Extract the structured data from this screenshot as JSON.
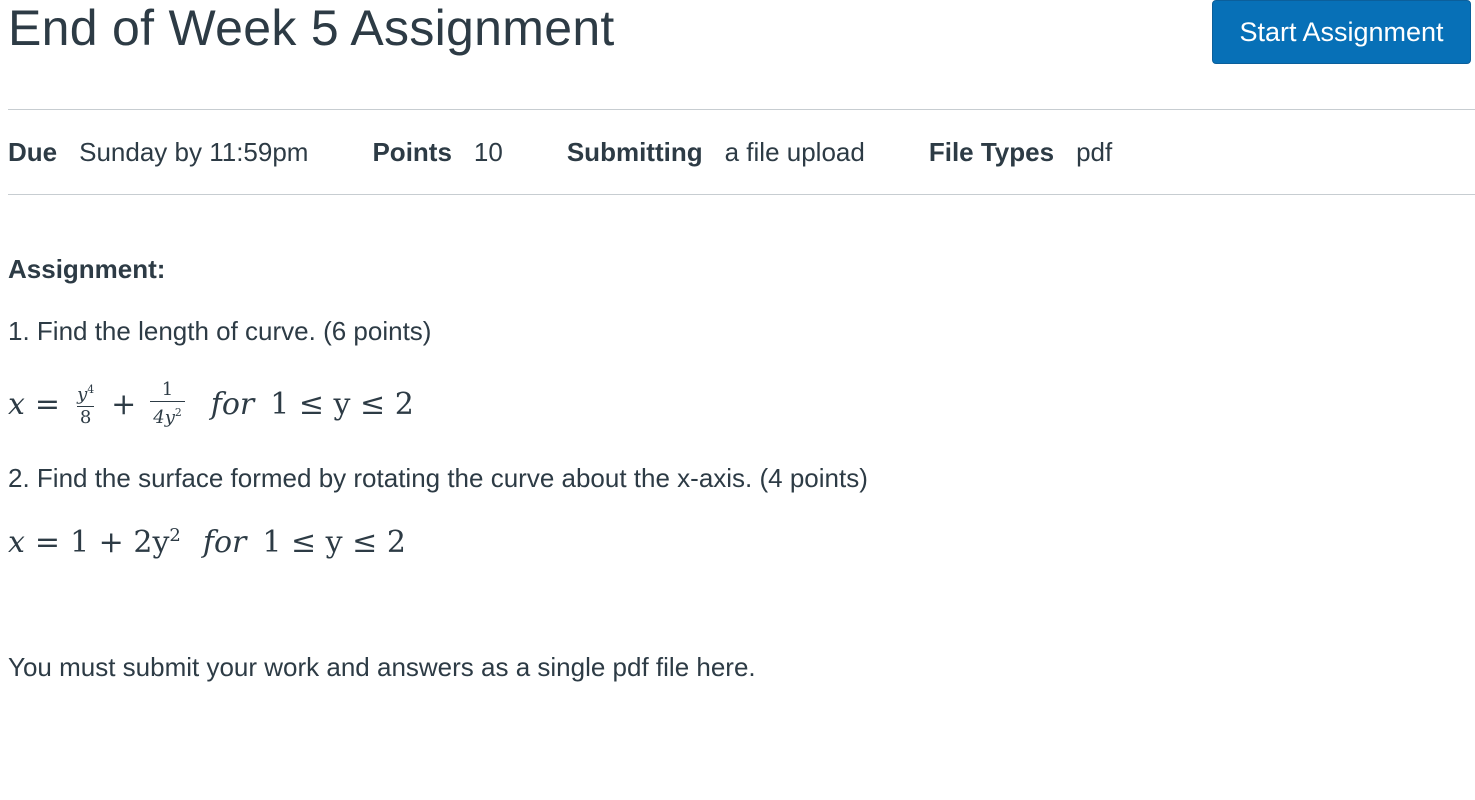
{
  "header": {
    "title": "End of Week 5 Assignment",
    "start_button_label": "Start Assignment"
  },
  "details": [
    {
      "label": "Due",
      "value": "Sunday by 11:59pm"
    },
    {
      "label": "Points",
      "value": "10"
    },
    {
      "label": "Submitting",
      "value": "a file upload"
    },
    {
      "label": "File Types",
      "value": "pdf"
    }
  ],
  "content": {
    "heading": "Assignment:",
    "question1": "1.  Find the length of curve. (6 points)",
    "equation1": {
      "lhs": "x",
      "eq": "=",
      "frac1_num": "y",
      "frac1_num_exp": "4",
      "frac1_den": "8",
      "plus": "+",
      "frac2_num": "1",
      "frac2_den": "4y",
      "frac2_den_exp": "2",
      "for_word": "for",
      "condition": "1 ≤ y ≤ 2"
    },
    "question2": "2.  Find the surface formed by rotating the curve about the x-axis. (4 points)",
    "equation2": {
      "lhs": "x",
      "eq": "=",
      "rhs_base": "1 + 2y",
      "rhs_exp": "2",
      "for_word": "for",
      "condition": "1 ≤ y ≤ 2"
    },
    "footer_note": "You must submit your work and answers as a single pdf file here."
  }
}
